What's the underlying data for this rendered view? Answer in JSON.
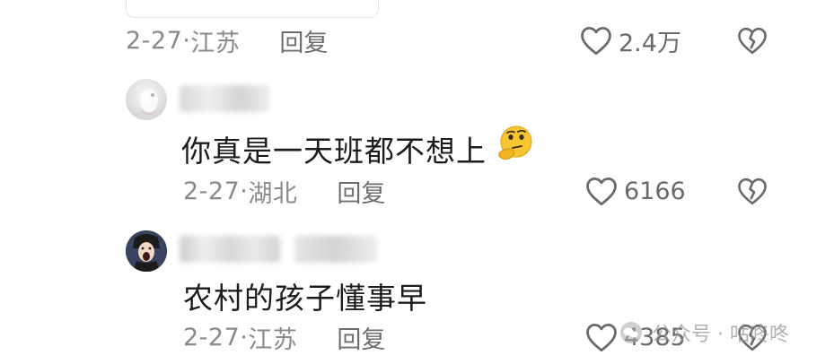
{
  "comments": [
    {
      "date": "2-27",
      "separator": "·",
      "location": "江苏",
      "reply_label": "回复",
      "likes": "2.4万"
    },
    {
      "text": "你真是一天班都不想上",
      "emoji": "thinking-emoji",
      "date": "2-27",
      "separator": "·",
      "location": "湖北",
      "reply_label": "回复",
      "likes": "6166"
    },
    {
      "text": "农村的孩子懂事早",
      "date": "2-27",
      "separator": "·",
      "location": "江苏",
      "reply_label": "回复",
      "likes": "4385"
    }
  ],
  "icons": {
    "like": "heart-outline-icon",
    "dislike": "broken-heart-icon"
  },
  "watermark": {
    "text": "公众号 · 咕咚咚"
  },
  "colors": {
    "meta": "#8a8a8a",
    "text": "#1c1c1c",
    "icon": "#6a6a6a"
  }
}
